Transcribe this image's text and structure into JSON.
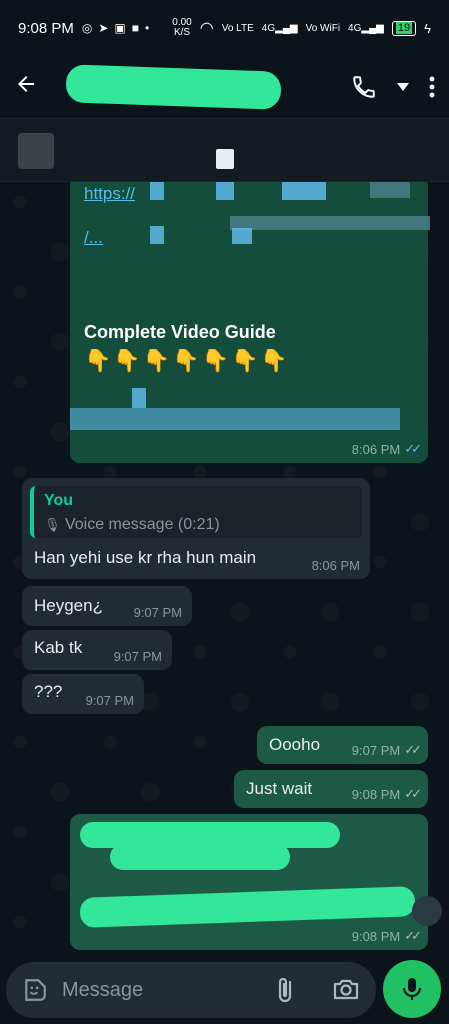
{
  "status_bar": {
    "time": "9:08 PM",
    "network_speed": "0.00",
    "network_unit": "K/S",
    "sim1": "Vo LTE",
    "sim1_gen": "4G",
    "sim2": "Vo WiFi",
    "sim2_gen": "4G",
    "battery": "19"
  },
  "header": {
    "back_icon": "arrow-left-icon",
    "call_icon": "phone-icon",
    "menu_icon": "more-vert-icon"
  },
  "messages": {
    "media": {
      "link_prefix": "https://",
      "link_line2": "/...",
      "title": "Complete Video Guide",
      "emojis": "👇👇👇👇👇👇👇",
      "time": "8:06 PM"
    },
    "reply": {
      "quote_author": "You",
      "quote_text": "Voice message (0:21)",
      "text": "Han yehi use kr rha hun main",
      "time": "8:06 PM"
    },
    "m1": {
      "text": "Heygen¿",
      "time": "9:07 PM"
    },
    "m2": {
      "text": "Kab tk",
      "time": "9:07 PM"
    },
    "m3": {
      "text": "???",
      "time": "9:07 PM"
    },
    "m4": {
      "text": "Oooho",
      "time": "9:07 PM"
    },
    "m5": {
      "text": "Just wait",
      "time": "9:08 PM"
    },
    "m6": {
      "time": "9:08 PM"
    }
  },
  "composer": {
    "placeholder": "Message"
  },
  "colors": {
    "accent": "#21c063",
    "outgoing_bubble": "#1d5a45",
    "incoming_bubble": "#202c33",
    "redaction": "#33e79a",
    "link": "#53bdeb"
  }
}
